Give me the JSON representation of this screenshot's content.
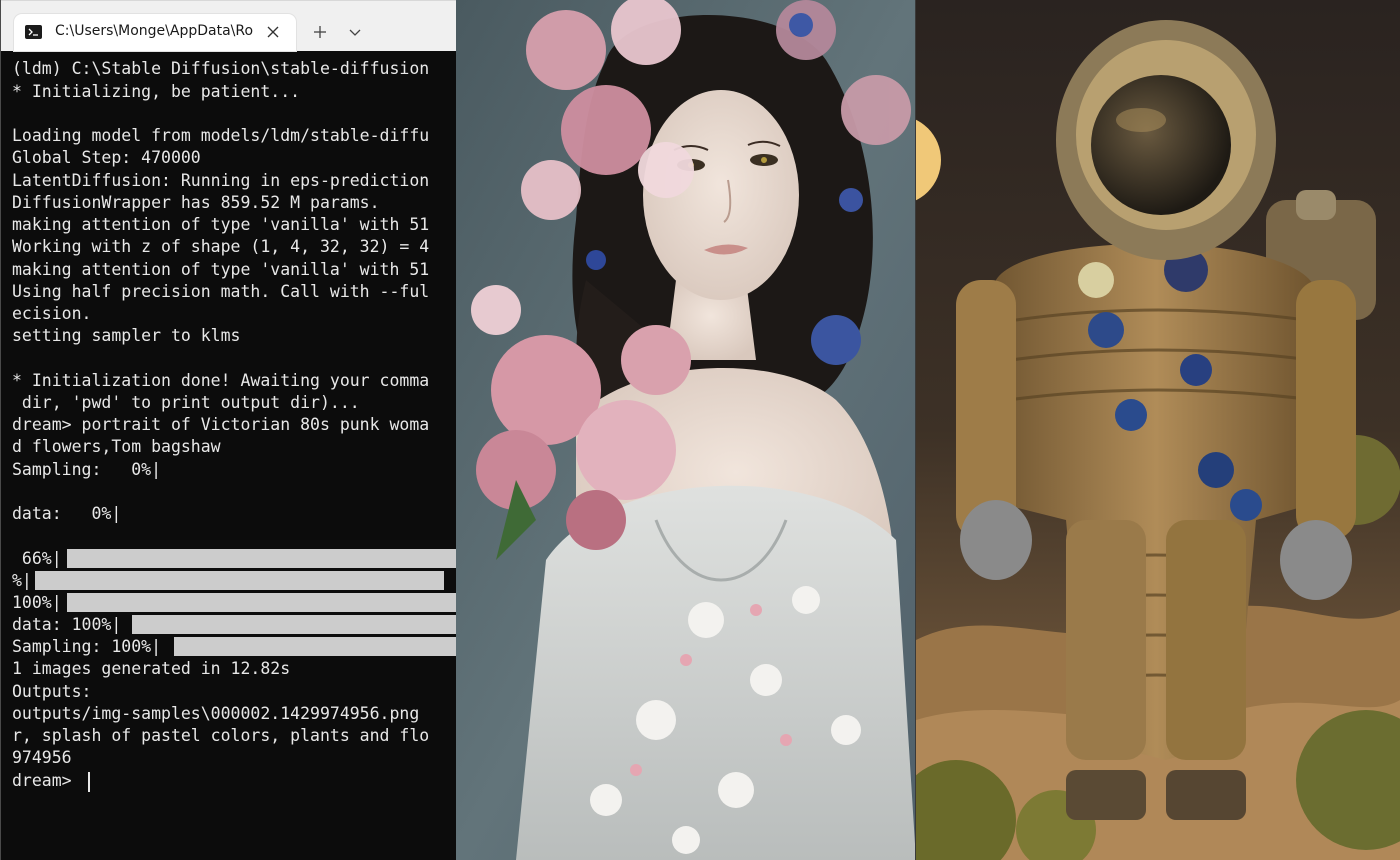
{
  "terminal": {
    "tab_title": "C:\\Users\\Monge\\AppData\\Ro",
    "lines": [
      "(ldm) C:\\Stable Diffusion\\stable-diffusion",
      "* Initializing, be patient...",
      "",
      "Loading model from models/ldm/stable-diffu",
      "Global Step: 470000",
      "LatentDiffusion: Running in eps-prediction",
      "DiffusionWrapper has 859.52 M params.",
      "making attention of type 'vanilla' with 51",
      "Working with z of shape (1, 4, 32, 32) = 4",
      "making attention of type 'vanilla' with 51",
      "Using half precision math. Call with --ful",
      "ecision.",
      "setting sampler to klms",
      "",
      "* Initialization done! Awaiting your comma",
      " dir, 'pwd' to print output dir)...",
      "dream> portrait of Victorian 80s punk woma",
      "d flowers,Tom bagshaw",
      "Sampling:   0%|",
      "",
      "data:   0%|",
      "",
      " 66%|",
      "%|",
      "100%|",
      "data: 100%|",
      "Sampling: 100%|",
      "1 images generated in 12.82s",
      "Outputs:",
      "outputs/img-samples\\000002.1429974956.png",
      "r, splash of pastel colors, plants and flo",
      "974956",
      "dream> "
    ],
    "progress_bars": [
      {
        "label": " 66%|",
        "value": 1.0
      },
      {
        "label": "%|",
        "value": 0.98
      },
      {
        "label": "100%|",
        "value": 1.0
      },
      {
        "label": "data: 100%|",
        "value": 1.0
      },
      {
        "label": "Sampling: 100%|",
        "value": 1.0
      }
    ],
    "colors": {
      "background": "#0c0c0c",
      "text": "#e8e8e8",
      "bar": "#cccccc",
      "tabbar": "#f0f0f0"
    }
  },
  "icons": {
    "tab": "terminal-icon",
    "close": "close-icon",
    "new_tab": "plus-icon",
    "dropdown": "chevron-down-icon"
  },
  "images": [
    {
      "subject": "portrait-flowers-woman",
      "dominant_color": "#5b6b70"
    },
    {
      "subject": "astronaut-desert",
      "dominant_color": "#6b5330"
    }
  ]
}
